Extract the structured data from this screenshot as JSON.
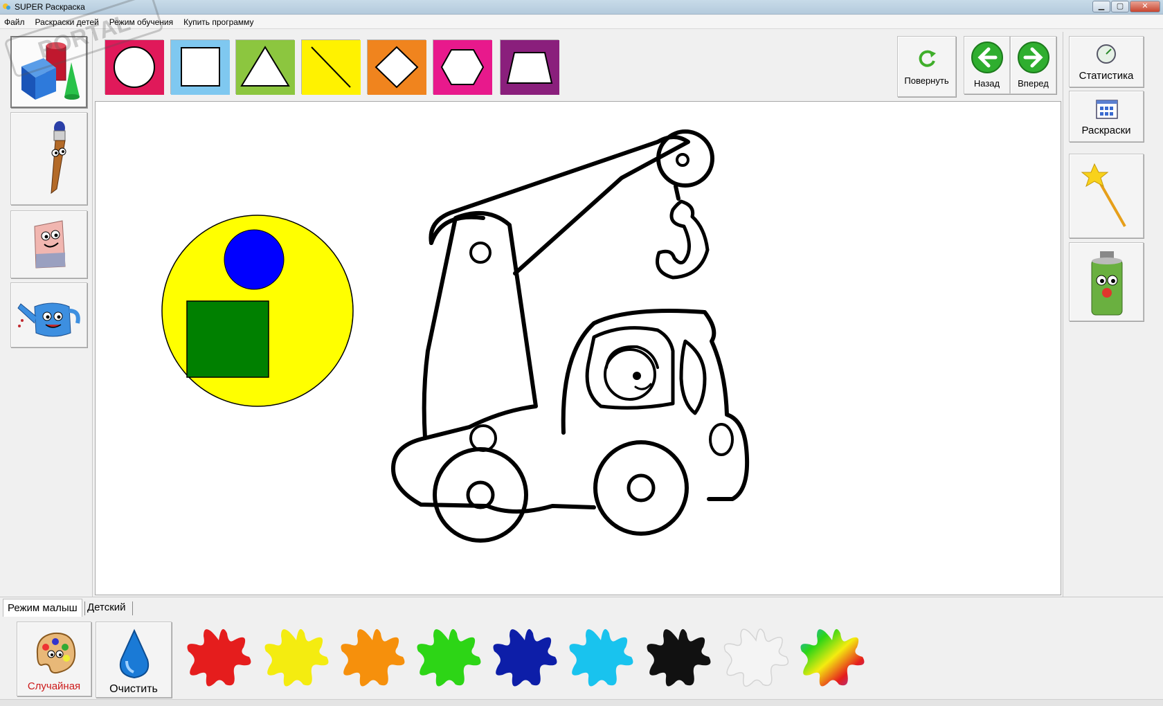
{
  "window": {
    "title": "SUPER Раскраска"
  },
  "menu": [
    "Файл",
    "Раскраски детей",
    "Режим обучения",
    "Купить программу"
  ],
  "watermark": "PORTAL",
  "toolbar": {
    "shapes": [
      {
        "name": "circle",
        "bg": "#e0195a"
      },
      {
        "name": "square",
        "bg": "#7fc8f0"
      },
      {
        "name": "triangle",
        "bg": "#8cc63f"
      },
      {
        "name": "line",
        "bg": "#fff200"
      },
      {
        "name": "diamond",
        "bg": "#f0841e"
      },
      {
        "name": "hexagon",
        "bg": "#e8198c"
      },
      {
        "name": "trapezoid",
        "bg": "#8a1f7c"
      }
    ],
    "rotate_label": "Повернуть",
    "back_label": "Назад",
    "forward_label": "Вперед"
  },
  "right_panel": {
    "stats_label": "Статистика",
    "coloring_label": "Раскраски"
  },
  "canvas": {
    "shapes_colors": {
      "big_circle": "#ffff00",
      "small_circle": "#0000ff",
      "square": "#008000"
    }
  },
  "tabs": {
    "baby_mode": "Режим малыш",
    "kids": "Детский"
  },
  "bottom": {
    "random_label": "Случайная",
    "clear_label": "Очистить",
    "palette": [
      {
        "name": "red",
        "color": "#e51d1d"
      },
      {
        "name": "yellow",
        "color": "#f4ec10"
      },
      {
        "name": "orange",
        "color": "#f6900c"
      },
      {
        "name": "green",
        "color": "#2dd516"
      },
      {
        "name": "dark-blue",
        "color": "#0d1ea8"
      },
      {
        "name": "light-blue",
        "color": "#19c3ee"
      },
      {
        "name": "black",
        "color": "#111111"
      },
      {
        "name": "white",
        "color": "#f4f4f4"
      },
      {
        "name": "rainbow",
        "color": "#8844cc"
      }
    ]
  }
}
